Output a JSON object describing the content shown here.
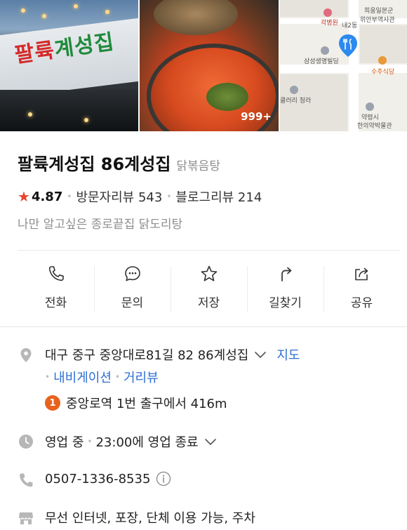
{
  "photos": {
    "storefront_sign": "팔륙계성집",
    "food_photo_count": "999+",
    "map_labels": {
      "label1": "희움일본군",
      "label2": "위안부역사관",
      "label3": "곽병원",
      "label4": "내2동",
      "label5": "삼성생명빌딩",
      "label6": "수주식당",
      "label7": "클러리 청라",
      "label8": "약령시",
      "label9": "한의약박물관"
    }
  },
  "place": {
    "name": "팔륙계성집 86계성집",
    "category": "닭볶음탕",
    "rating": "4.87",
    "visitor_reviews": "방문자리뷰 543",
    "blog_reviews": "블로그리뷰 214",
    "description": "나만 알고싶은 종로끝집 닭도리탕"
  },
  "actions": [
    {
      "label": "전화",
      "icon": "phone-icon"
    },
    {
      "label": "문의",
      "icon": "chat-icon"
    },
    {
      "label": "저장",
      "icon": "star-icon"
    },
    {
      "label": "길찾기",
      "icon": "directions-icon"
    },
    {
      "label": "공유",
      "icon": "share-icon"
    }
  ],
  "info": {
    "address": "대구 중구 중앙대로81길 82 86계성집",
    "map_link": "지도",
    "navigation": "내비게이션",
    "street_view": "거리뷰",
    "station_number": "1",
    "station_text": "중앙로역 1번 출구에서 416m",
    "status": "영업 중",
    "closing": "23:00에 영업 종료",
    "phone": "0507-1336-8535",
    "amenities": "무선 인터넷, 포장, 단체 이용 가능, 주차"
  },
  "colors": {
    "accent_blue": "#2f6fd1",
    "star_red": "#e8442e",
    "badge_orange": "#e8621e",
    "map_pin": "#2b8af0"
  }
}
